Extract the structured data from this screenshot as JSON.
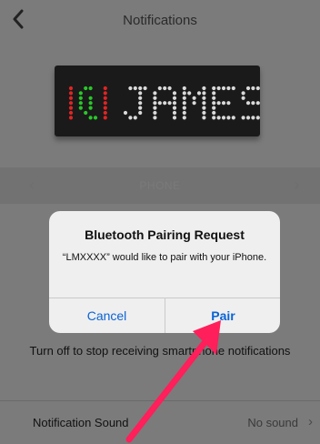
{
  "header": {
    "title": "Notifications",
    "back_icon": "chevron-left-icon"
  },
  "device": {
    "display_text": "JAMES",
    "icon": "phone-ringing-icon",
    "icon_color": "#28c828",
    "ring_color": "#e02424",
    "text_color": "#d9d9d9"
  },
  "tab_strip": {
    "label": "PHONE"
  },
  "helper_text": "Turn off to stop receiving smartphone notifications",
  "settings_row": {
    "label": "Notification Sound",
    "value": "No sound"
  },
  "dialog": {
    "title": "Bluetooth Pairing Request",
    "message": "“LMXXXX” would like to pair with your iPhone.",
    "cancel_label": "Cancel",
    "pair_label": "Pair",
    "accent_color": "#0a63d6"
  },
  "annotation": {
    "arrow_color": "#ff1f5a"
  }
}
